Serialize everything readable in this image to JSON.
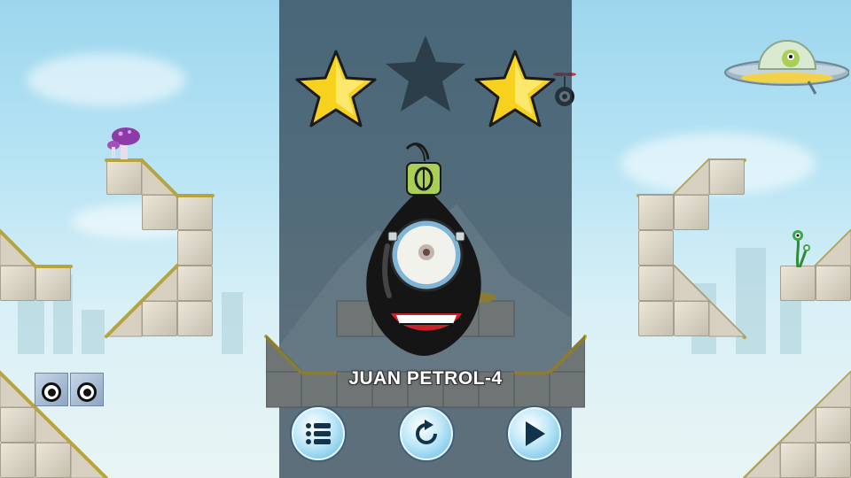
{
  "level": {
    "name": "JUAN PETROL-4"
  },
  "stars": {
    "earned": 2,
    "total": 3
  },
  "colors": {
    "star_gold": "#f6d21e",
    "star_empty": "#2b3e4a",
    "overlay": "#283c4b",
    "button_blue": "#5fb7e2"
  },
  "buttons": [
    {
      "name": "level-list-button",
      "icon": "list-icon"
    },
    {
      "name": "restart-button",
      "icon": "restart-icon"
    },
    {
      "name": "next-level-button",
      "icon": "play-icon"
    }
  ]
}
